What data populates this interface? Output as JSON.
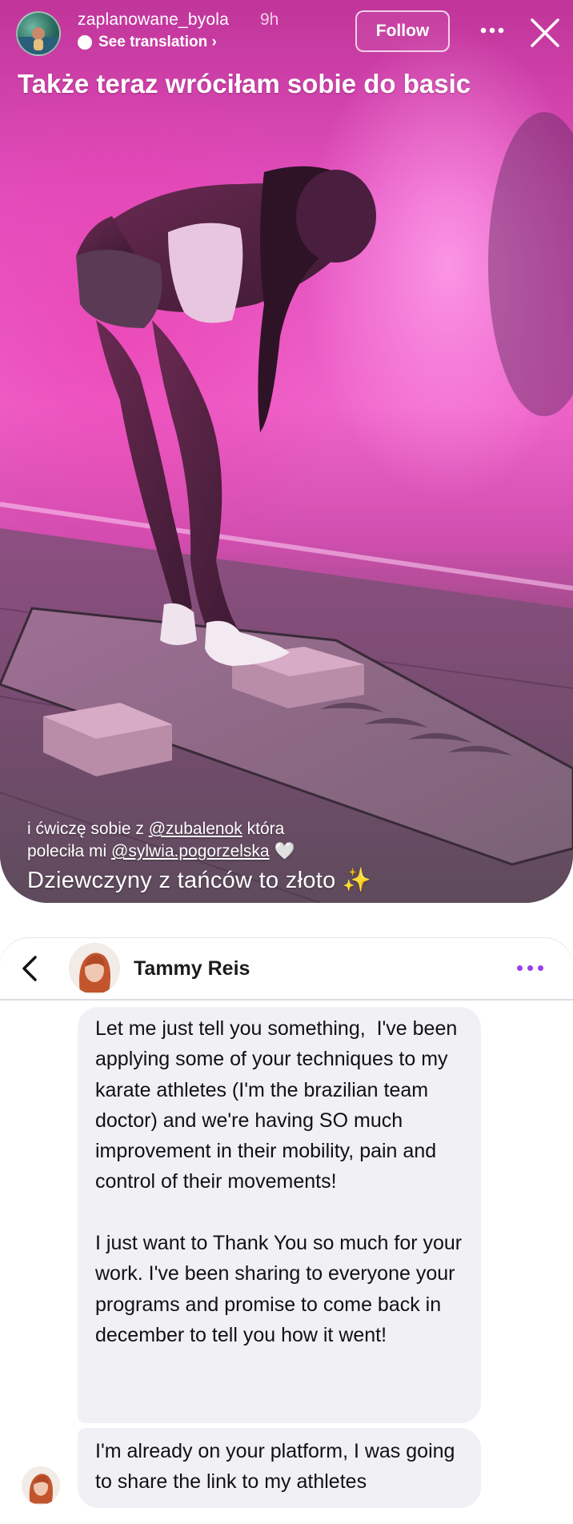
{
  "story": {
    "username": "zaplanowane_byola",
    "time_ago": "9h",
    "see_translation": "See translation ›",
    "follow_label": "Follow",
    "headline": "Także teraz wróciłam sobie do basic",
    "caption_line1_prefix": "i ćwiczę sobie z ",
    "caption_mention1": "@zubalenok",
    "caption_line1_suffix": " która",
    "caption_line2_prefix": "poleciła mi ",
    "caption_mention2": "@sylwia.pogorzelska",
    "caption_heart": "🤍",
    "caption_big": "Dziewczyny z tańców to złoto ✨",
    "icons": [
      "more-icon",
      "close-icon",
      "translate-icon"
    ]
  },
  "chat": {
    "contact_name": "Tammy Reis",
    "accent_color": "#9b3fe8",
    "messages": [
      {
        "text": "Let me just tell you something,  I've been applying some of your techniques to my karate athletes (I'm the brazilian team doctor) and we're having SO much improvement in their mobility, pain and control of their movements!\n\nI just want to Thank You so much for your work. I've been sharing to everyone your programs and promise to come back in december to tell you how it went!"
      },
      {
        "text": "I'm already on your platform, I was going to share the link to my athletes"
      }
    ]
  }
}
